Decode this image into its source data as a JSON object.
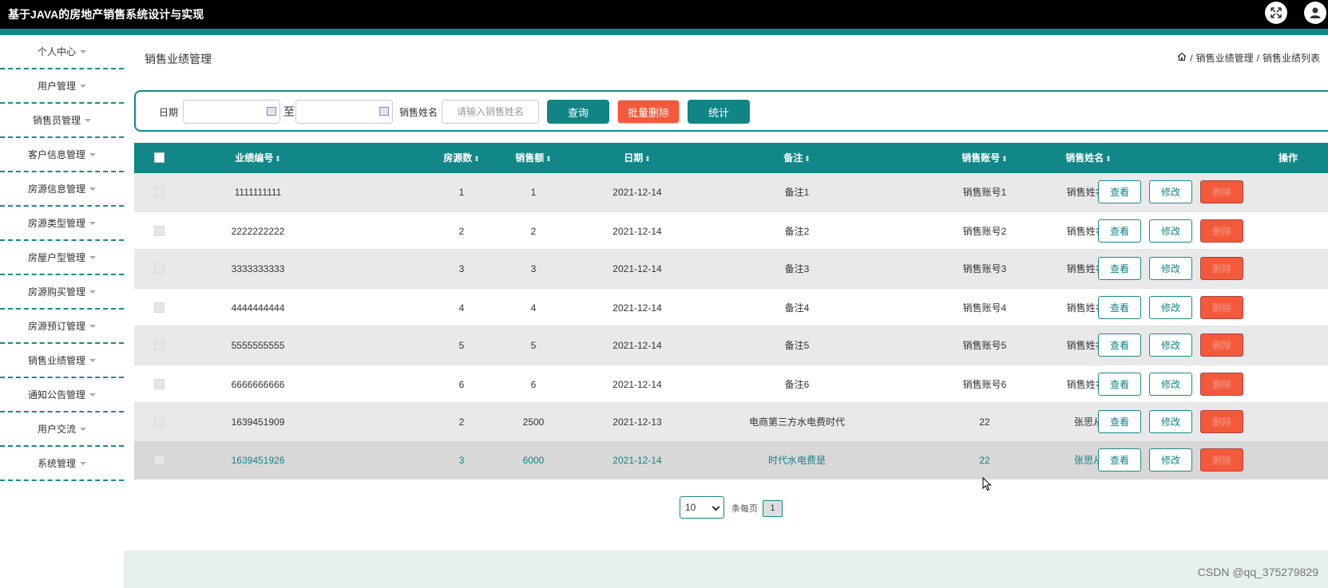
{
  "app": {
    "title": "基于JAVA的房地产销售系统设计与实现"
  },
  "header": {
    "fullscreen_icon": "fullscreen-icon",
    "user_icon": "user-icon"
  },
  "sidebar": {
    "items": [
      {
        "label": "个人中心"
      },
      {
        "label": "用户管理"
      },
      {
        "label": "销售员管理"
      },
      {
        "label": "客户信息管理"
      },
      {
        "label": "房源信息管理"
      },
      {
        "label": "房源类型管理"
      },
      {
        "label": "房屋户型管理"
      },
      {
        "label": "房源购买管理"
      },
      {
        "label": "房源预订管理"
      },
      {
        "label": "销售业绩管理"
      },
      {
        "label": "通知公告管理"
      },
      {
        "label": "用户交流"
      },
      {
        "label": "系统管理"
      }
    ]
  },
  "page": {
    "title": "销售业绩管理",
    "breadcrumb": {
      "home_icon": "home-icon",
      "sep": "/",
      "level1": "销售业绩管理",
      "level2": "销售业绩列表"
    }
  },
  "search": {
    "date_label": "日期",
    "to_label": "至",
    "date_from": "",
    "date_to": "",
    "name_label": "销售姓名",
    "name_placeholder": "请输入销售姓名",
    "query_button": "查询",
    "batch_delete_button": "批量删除",
    "stats_button": "统计"
  },
  "table": {
    "sort_glyph": "⇕",
    "headers": [
      "业绩编号",
      "房源数",
      "销售额",
      "日期",
      "备注",
      "销售账号",
      "销售姓名",
      "操作"
    ],
    "rows": [
      {
        "id": "1111111111",
        "count": "1",
        "amount": "1",
        "date": "2021-12-14",
        "note": "备注1",
        "account": "销售账号1",
        "name": "销售姓名1"
      },
      {
        "id": "2222222222",
        "count": "2",
        "amount": "2",
        "date": "2021-12-14",
        "note": "备注2",
        "account": "销售账号2",
        "name": "销售姓名2"
      },
      {
        "id": "3333333333",
        "count": "3",
        "amount": "3",
        "date": "2021-12-14",
        "note": "备注3",
        "account": "销售账号3",
        "name": "销售姓名3"
      },
      {
        "id": "4444444444",
        "count": "4",
        "amount": "4",
        "date": "2021-12-14",
        "note": "备注4",
        "account": "销售账号4",
        "name": "销售姓名4"
      },
      {
        "id": "5555555555",
        "count": "5",
        "amount": "5",
        "date": "2021-12-14",
        "note": "备注5",
        "account": "销售账号5",
        "name": "销售姓名5"
      },
      {
        "id": "6666666666",
        "count": "6",
        "amount": "6",
        "date": "2021-12-14",
        "note": "备注6",
        "account": "销售账号6",
        "name": "销售姓名6"
      },
      {
        "id": "1639451909",
        "count": "2",
        "amount": "2500",
        "date": "2021-12-13",
        "note": "电商第三方水电费时代",
        "account": "22",
        "name": "张思从"
      },
      {
        "id": "1639451926",
        "count": "3",
        "amount": "6000",
        "date": "2021-12-14",
        "note": "时代水电费是",
        "account": "22",
        "name": "张思从"
      }
    ],
    "actions": {
      "view": "查看",
      "edit": "修改",
      "delete": "删除"
    }
  },
  "pagination": {
    "page_size": "10",
    "per_page_label": "条每页",
    "current_page": "1"
  },
  "watermark": "CSDN @qq_375279829",
  "colors": {
    "teal": "#118585",
    "header_bg": "#000000",
    "danger": "#f4593b"
  }
}
